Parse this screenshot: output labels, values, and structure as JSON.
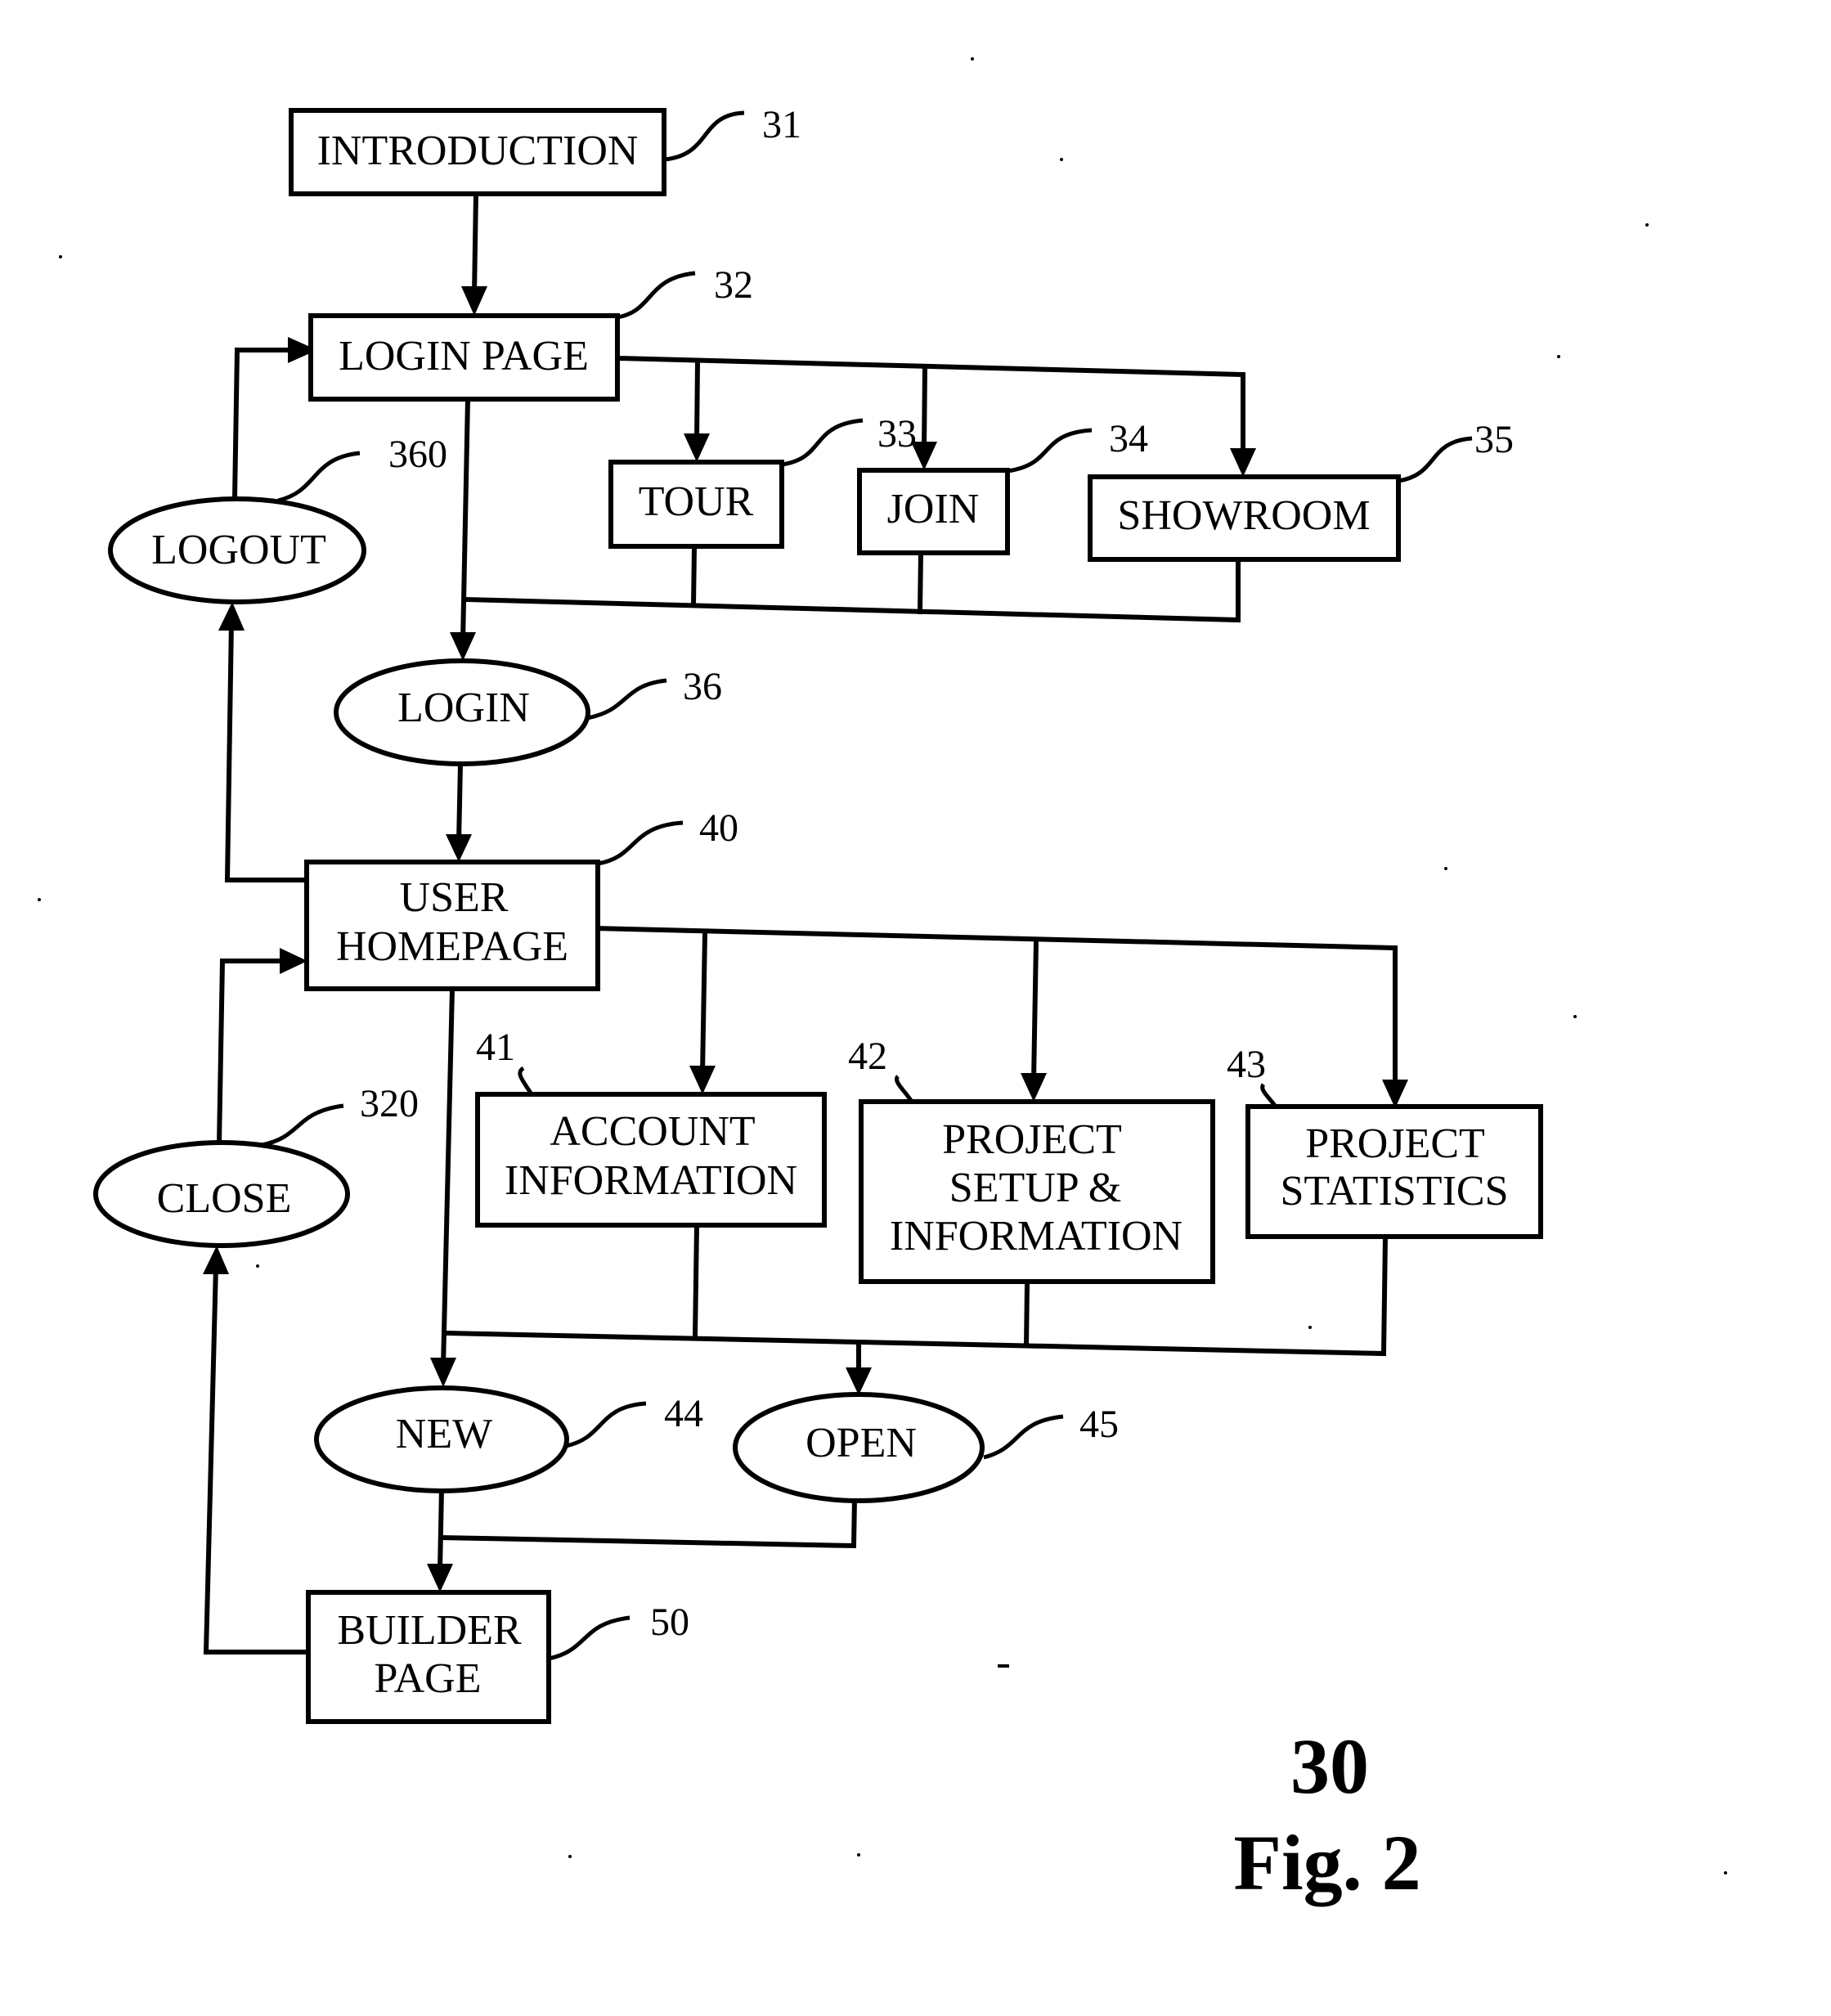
{
  "figure": {
    "number": "30",
    "caption": "Fig. 2"
  },
  "nodes": {
    "introduction": {
      "label": [
        "INTRODUCTION"
      ],
      "ref": "31",
      "shape": "rect"
    },
    "login_page": {
      "label": [
        "LOGIN PAGE"
      ],
      "ref": "32",
      "shape": "rect"
    },
    "tour": {
      "label": [
        "TOUR"
      ],
      "ref": "33",
      "shape": "rect"
    },
    "join": {
      "label": [
        "JOIN"
      ],
      "ref": "34",
      "shape": "rect"
    },
    "showroom": {
      "label": [
        "SHOWROOM"
      ],
      "ref": "35",
      "shape": "rect"
    },
    "logout": {
      "label": [
        "LOGOUT"
      ],
      "ref": "360",
      "shape": "ellipse"
    },
    "login": {
      "label": [
        "LOGIN"
      ],
      "ref": "36",
      "shape": "ellipse"
    },
    "user_homepage": {
      "label": [
        "USER",
        "HOMEPAGE"
      ],
      "ref": "40",
      "shape": "rect"
    },
    "account_information": {
      "label": [
        "ACCOUNT",
        "INFORMATION"
      ],
      "ref": "41",
      "shape": "rect"
    },
    "project_setup": {
      "label": [
        "PROJECT",
        "SETUP &",
        "INFORMATION"
      ],
      "ref": "42",
      "shape": "rect"
    },
    "project_statistics": {
      "label": [
        "PROJECT",
        "STATISTICS"
      ],
      "ref": "43",
      "shape": "rect"
    },
    "close": {
      "label": [
        "CLOSE"
      ],
      "ref": "320",
      "shape": "ellipse"
    },
    "new": {
      "label": [
        "NEW"
      ],
      "ref": "44",
      "shape": "ellipse"
    },
    "open": {
      "label": [
        "OPEN"
      ],
      "ref": "45",
      "shape": "ellipse"
    },
    "builder_page": {
      "label": [
        "BUILDER",
        "PAGE"
      ],
      "ref": "50",
      "shape": "rect"
    }
  },
  "edges": [
    {
      "from": "introduction",
      "to": "login_page"
    },
    {
      "from": "login_page",
      "to": "tour"
    },
    {
      "from": "login_page",
      "to": "join"
    },
    {
      "from": "login_page",
      "to": "showroom"
    },
    {
      "from": "login_page",
      "to": "login"
    },
    {
      "from": "tour",
      "to": "login"
    },
    {
      "from": "join",
      "to": "login"
    },
    {
      "from": "showroom",
      "to": "login"
    },
    {
      "from": "login",
      "to": "user_homepage"
    },
    {
      "from": "user_homepage",
      "to": "logout"
    },
    {
      "from": "logout",
      "to": "login_page"
    },
    {
      "from": "user_homepage",
      "to": "account_information"
    },
    {
      "from": "user_homepage",
      "to": "project_setup"
    },
    {
      "from": "user_homepage",
      "to": "project_statistics"
    },
    {
      "from": "user_homepage",
      "to": "new"
    },
    {
      "from": "account_information",
      "to": "open"
    },
    {
      "from": "project_setup",
      "to": "open"
    },
    {
      "from": "project_statistics",
      "to": "open"
    },
    {
      "from": "new",
      "to": "builder_page"
    },
    {
      "from": "open",
      "to": "builder_page"
    },
    {
      "from": "builder_page",
      "to": "close"
    },
    {
      "from": "close",
      "to": "user_homepage"
    }
  ]
}
